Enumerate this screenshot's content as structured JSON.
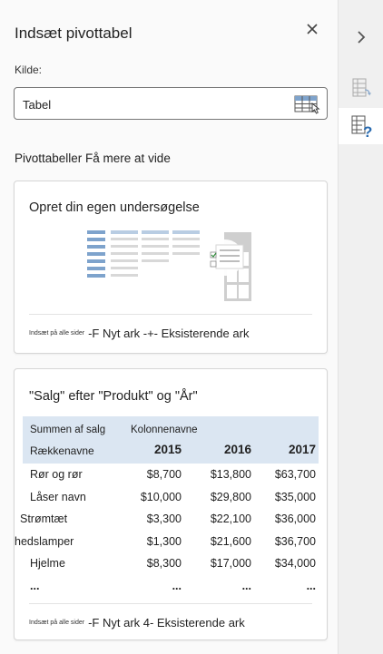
{
  "pane": {
    "title": "Indsæt pivottabel",
    "source_label": "Kilde:",
    "source_value": "Tabel",
    "heading": "Pivottabeller Få mere at vide"
  },
  "card1": {
    "title": "Opret din egen undersøgelse",
    "insert_small": "Indsæt på alle sider",
    "insert_text": "-F Nyt ark -+- Eksisterende ark"
  },
  "card2": {
    "title": "\"Salg\" efter \"Produkt\" og \"År\"",
    "sum_label": "Summen af salg",
    "col_label": "Kolonnenavne",
    "row_label": "Rækkenavne",
    "years": [
      "2015",
      "2016",
      "2017"
    ],
    "rows": [
      {
        "label": "Rør og rør",
        "values": [
          "$8,700",
          "$13,800",
          "$63,700"
        ]
      },
      {
        "label": "Låser navn",
        "values": [
          "$10,000",
          "$29,800",
          "$35,000"
        ]
      },
      {
        "label": "Strømtæt",
        "values": [
          "$3,300",
          "$22,100",
          "$36,000"
        ]
      },
      {
        "label": "hedslamper",
        "values": [
          "$1,300",
          "$21,600",
          "$36,700"
        ]
      },
      {
        "label": "Hjelme",
        "values": [
          "$8,300",
          "$17,000",
          "$34,000"
        ]
      },
      {
        "label": "...",
        "values": [
          "...",
          "...",
          "..."
        ]
      }
    ],
    "insert_small": "Indsæt på alle sider",
    "insert_text": "-F Nyt ark 4- Eksisterende ark"
  },
  "icons": {
    "close": "close-icon",
    "collapse": "chevron-right-icon",
    "source_picker": "table-select-icon",
    "rail_pivot": "pivot-table-icon",
    "rail_help": "help-icon"
  },
  "colors": {
    "table_header": "#dbe6f2",
    "accent_blue": "#7ea3cc",
    "check_green": "#2e8b3a"
  }
}
